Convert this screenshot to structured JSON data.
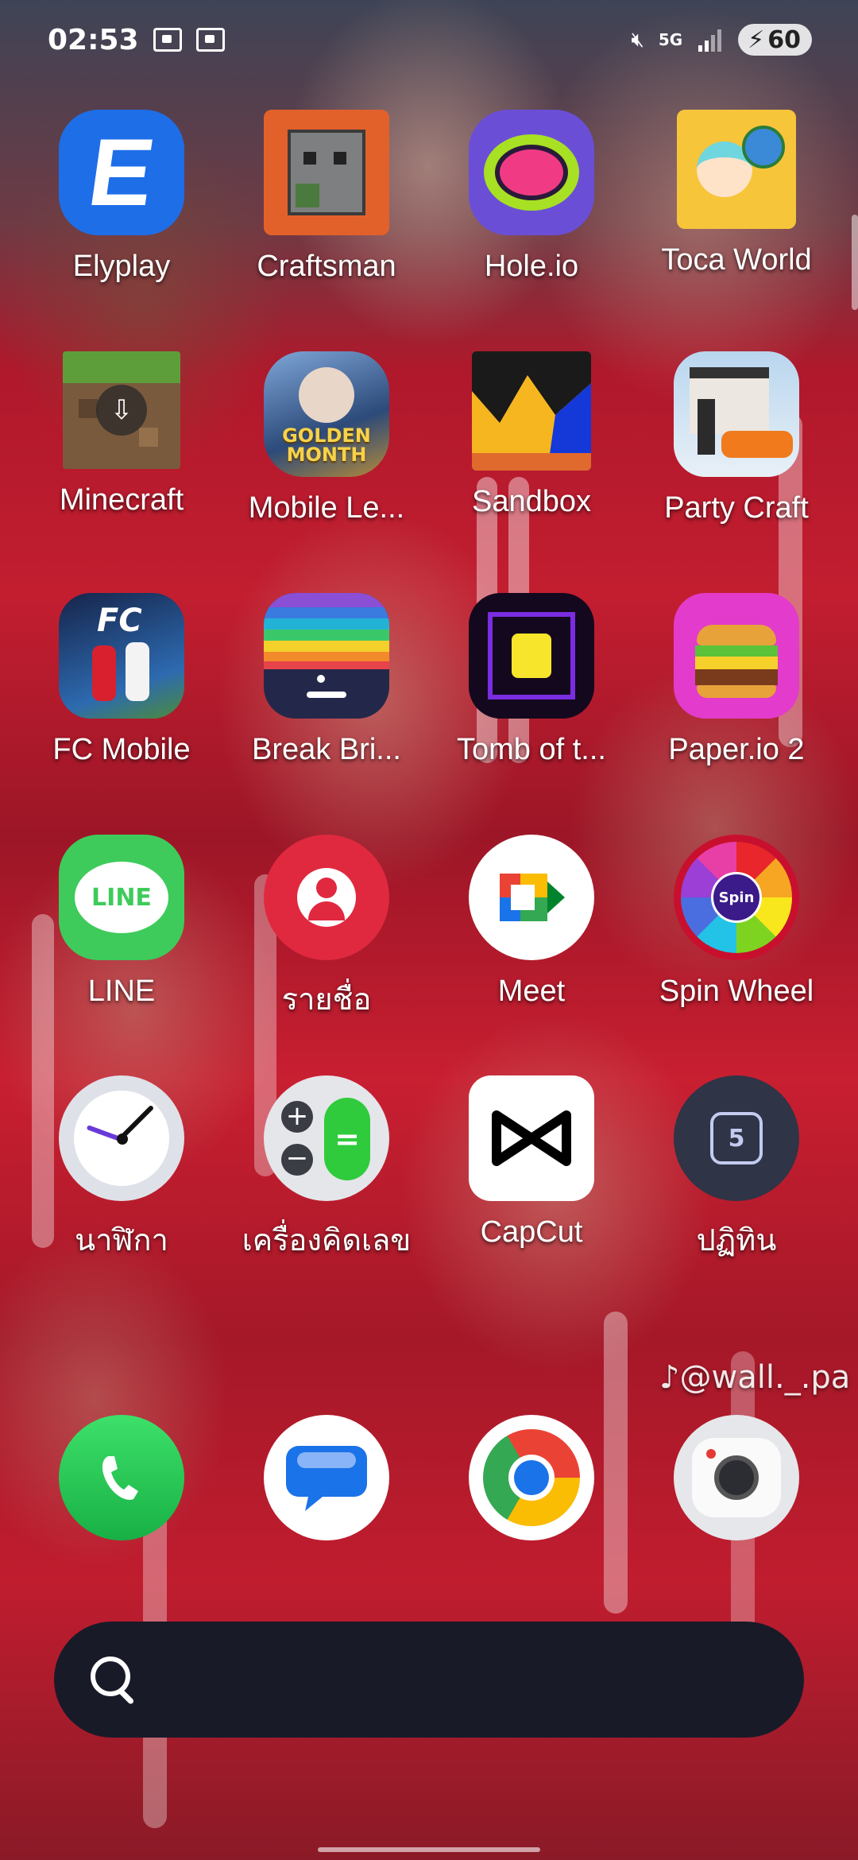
{
  "status_bar": {
    "time": "02:53",
    "network": "5G",
    "battery": "60"
  },
  "apps": [
    {
      "label": "Elyplay",
      "icon": "elyplay-icon"
    },
    {
      "label": "Craftsman",
      "icon": "craftsman-icon"
    },
    {
      "label": "Hole.io",
      "icon": "hole-io-icon"
    },
    {
      "label": "Toca World",
      "icon": "toca-world-icon"
    },
    {
      "label": "Minecraft",
      "icon": "minecraft-icon"
    },
    {
      "label": "Mobile Le...",
      "icon": "mobile-legends-icon"
    },
    {
      "label": "Sandbox",
      "icon": "sandbox-icon"
    },
    {
      "label": "Party Craft",
      "icon": "party-craft-icon"
    },
    {
      "label": "FC Mobile",
      "icon": "fc-mobile-icon"
    },
    {
      "label": "Break Bri...",
      "icon": "break-bricks-icon"
    },
    {
      "label": "Tomb of t...",
      "icon": "tomb-of-the-mask-icon"
    },
    {
      "label": "Paper.io 2",
      "icon": "paper-io-icon"
    },
    {
      "label": "LINE",
      "icon": "line-icon"
    },
    {
      "label": "รายชื่อ",
      "icon": "contacts-icon"
    },
    {
      "label": "Meet",
      "icon": "meet-icon"
    },
    {
      "label": "Spin Wheel",
      "icon": "spin-wheel-icon"
    },
    {
      "label": "นาฬิกา",
      "icon": "clock-icon"
    },
    {
      "label": "เครื่องคิดเลข",
      "icon": "calculator-icon"
    },
    {
      "label": "CapCut",
      "icon": "capcut-icon"
    },
    {
      "label": "ปฏิทิน",
      "icon": "calendar-icon"
    }
  ],
  "icon_text": {
    "elyplay": "E",
    "mobile_legends": "GOLDEN MONTH",
    "fc_mobile": "FC",
    "line": "LINE",
    "spin": "Spin",
    "calendar_day": "5"
  },
  "dock": [
    {
      "label": "Phone",
      "icon": "phone-icon"
    },
    {
      "label": "Messages",
      "icon": "messages-icon"
    },
    {
      "label": "Chrome",
      "icon": "chrome-icon"
    },
    {
      "label": "Camera",
      "icon": "camera-icon"
    }
  ],
  "wallpaper": {
    "watermark": "♪@wall._.pa"
  }
}
